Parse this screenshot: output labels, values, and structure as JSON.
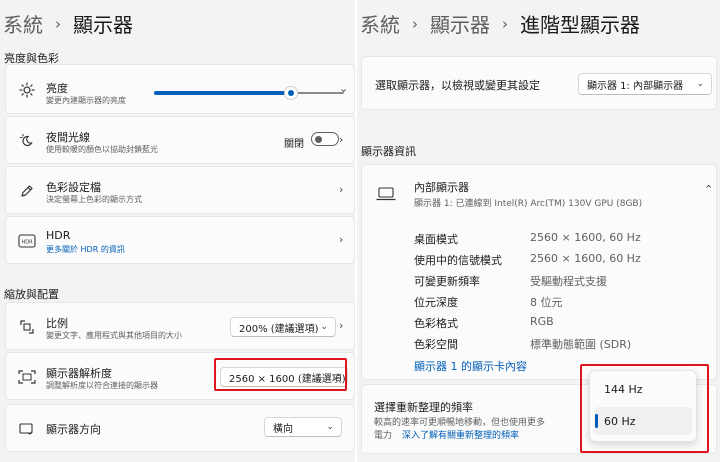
{
  "left": {
    "breadcrumb": {
      "parent": "系統",
      "separator": "›",
      "current": "顯示器"
    },
    "section_brightness": "亮度與色彩",
    "brightness": {
      "title": "亮度",
      "subtitle": "變更內建顯示器的亮度",
      "value_percent": 72,
      "chevron": "⌄"
    },
    "night_light": {
      "title": "夜間光線",
      "subtitle": "使用較暖的顏色以協助封鎖藍光",
      "state": "關閉",
      "chevron": "›"
    },
    "color_profile": {
      "title": "色彩設定檔",
      "subtitle": "決定螢幕上色彩的顯示方式",
      "chevron": "›"
    },
    "hdr": {
      "title": "HDR",
      "subtitle": "更多關於 HDR 的資訊",
      "chevron": "›"
    },
    "section_scale": "縮放與配置",
    "scale": {
      "title": "比例",
      "subtitle": "變更文字、應用程式與其他項目的大小",
      "value": "200% (建議選項)",
      "dd_chevron": "⌄",
      "chevron": "›"
    },
    "resolution": {
      "title": "顯示器解析度",
      "subtitle": "調整解析度以符合連接的顯示器",
      "value": "2560 × 1600 (建議選項)",
      "dd_chevron": "⌄"
    },
    "orientation": {
      "title": "顯示器方向",
      "value": "橫向",
      "dd_chevron": "⌄"
    }
  },
  "right": {
    "breadcrumb": {
      "root": "系統",
      "separator": "›",
      "parent": "顯示器",
      "current": "進階型顯示器"
    },
    "select_display": {
      "label": "選取顯示器，以檢視或變更其設定",
      "value": "顯示器 1: 內部顯示器",
      "dd_chevron": "⌄"
    },
    "section_info": "顯示器資訊",
    "display": {
      "title": "內部顯示器",
      "subtitle": "顯示器 1: 已連線到 Intel(R) Arc(TM) 130V GPU (8GB)",
      "collapse": "⌃"
    },
    "info_rows": [
      {
        "key": "桌面模式",
        "value": "2560 × 1600, 60 Hz"
      },
      {
        "key": "使用中的信號模式",
        "value": "2560 × 1600, 60 Hz"
      },
      {
        "key": "可變更新頻率",
        "value": "受驅動程式支援"
      },
      {
        "key": "位元深度",
        "value": "8 位元"
      },
      {
        "key": "色彩格式",
        "value": "RGB"
      },
      {
        "key": "色彩空間",
        "value": "標準動態範圍 (SDR)"
      }
    ],
    "adapter_link": "顯示器 1 的顯示卡內容",
    "refresh": {
      "title": "選擇重新整理的頻率",
      "desc": "較高的速率可更順暢地移動，但也使用更多",
      "desc2": "電力",
      "link": "深入了解有關重新整理的頻率"
    },
    "refresh_options": [
      "144 Hz",
      "60 Hz"
    ],
    "refresh_selected": "60 Hz"
  },
  "colors": {
    "accent": "#005fb8",
    "highlight_box": "#e0141c"
  }
}
